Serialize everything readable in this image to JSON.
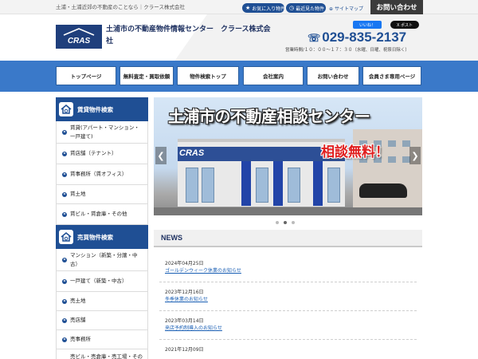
{
  "topbar": {
    "tagline": "土浦・土浦近郊の不動産のことなら｜クラース株式会社",
    "favorites_label": "お気に入り物件",
    "recent_label": "最近見た物件",
    "sitemap_label": "サイトマップ",
    "contact_label": "お問い合わせ"
  },
  "header": {
    "logo_text": "CRAS",
    "site_title": "土浦市の不動産物件情報センター　クラース株式会社",
    "fb_like": "いいね！",
    "x_post": "X ポスト",
    "phone": "029-835-2137",
    "hours": "営業時間/１０：００～１７：３０（水曜、日曜、祝祭日除く）"
  },
  "nav": {
    "items": [
      "トップページ",
      "無料査定・買取依頼",
      "物件検索トップ",
      "会社案内",
      "お問い合わせ",
      "会員さま専用ページ"
    ]
  },
  "sidebar": {
    "rental_title": "賃貸物件検索",
    "rental_items": [
      "賃貸(アパート・マンション・一戸建て)",
      "賃店舗（テナント）",
      "賃事務所（賃オフィス）",
      "賃土地",
      "賃ビル・賃倉庫・その他"
    ],
    "sale_title": "売買物件検索",
    "sale_items": [
      "マンション（新築・分譲・中古）",
      "一戸建て（新築・中古）",
      "売土地",
      "売店舗",
      "売事務所",
      "売ビル・売倉庫・売工場・その他"
    ]
  },
  "slider": {
    "headline": "土浦市の不動産相談センター",
    "badge": "相談無料！",
    "sign": "CRAS",
    "prev": "❮",
    "next": "❯",
    "active_index": 1,
    "slide_count": 3
  },
  "news": {
    "title": "NEWS",
    "items": [
      {
        "date": "2024年04月25日",
        "text": "ゴールデンウィーク休業のお知らせ"
      },
      {
        "date": "2023年12月16日",
        "text": "冬季休業のお知らせ"
      },
      {
        "date": "2023年03月14日",
        "text": "来店予約制導入のお知らせ"
      },
      {
        "date": "2021年12月09日",
        "text": ""
      }
    ]
  },
  "colors": {
    "brand_navy": "#1f4f94",
    "nav_blue": "#3a79c9",
    "badge_red": "#e01e1e"
  }
}
